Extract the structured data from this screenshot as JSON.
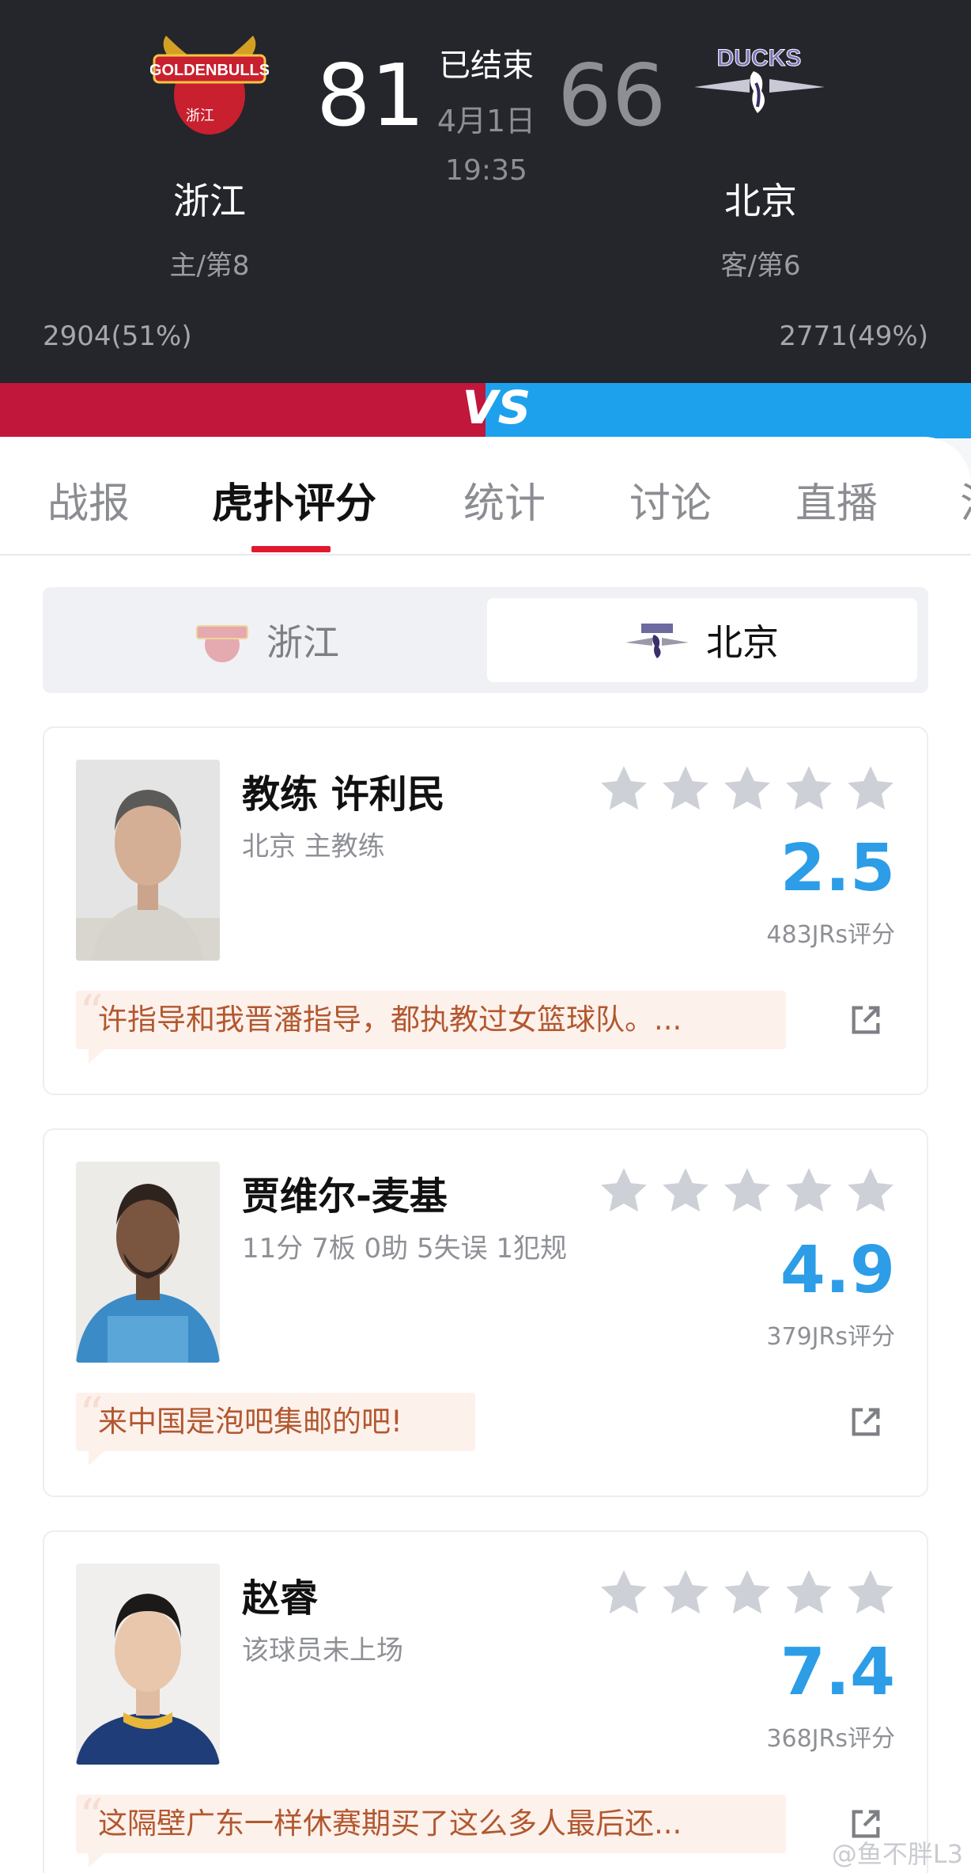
{
  "match": {
    "status": "已结束",
    "date": "4月1日",
    "time": "19:35",
    "home": {
      "name": "浙江",
      "rank": "主/第8",
      "score": "81",
      "support": "2904(51%)",
      "logo_text": "GOLDENBULLS"
    },
    "away": {
      "name": "北京",
      "rank": "客/第6",
      "score": "66",
      "support": "2771(49%)",
      "logo_text": "DUCKS"
    },
    "vs": "VS",
    "colors": {
      "home": "#c0173a",
      "away": "#1ea1ec"
    }
  },
  "tabs": [
    "战报",
    "虎扑评分",
    "统计",
    "讨论",
    "直播",
    "油"
  ],
  "active_tab": "虎扑评分",
  "toggle": {
    "home": "浙江",
    "away": "北京",
    "selected": "北京"
  },
  "players": [
    {
      "name": "教练 许利民",
      "desc": "北京 主教练",
      "rating": "2.5",
      "count": "483JRs评分",
      "comment": "许指导和我晋潘指导，都执教过女篮球队。..."
    },
    {
      "name": "贾维尔-麦基",
      "desc": "11分 7板 0助 5失误 1犯规",
      "rating": "4.9",
      "count": "379JRs评分",
      "comment": "来中国是泡吧集邮的吧!"
    },
    {
      "name": "赵睿",
      "desc": "该球员未上场",
      "rating": "7.4",
      "count": "368JRs评分",
      "comment": "这隔壁广东一样休赛期买了这么多人最后还..."
    }
  ],
  "watermark": "@鱼不胖L3",
  "icons": [
    "star-icon",
    "share-icon",
    "quote-icon"
  ]
}
